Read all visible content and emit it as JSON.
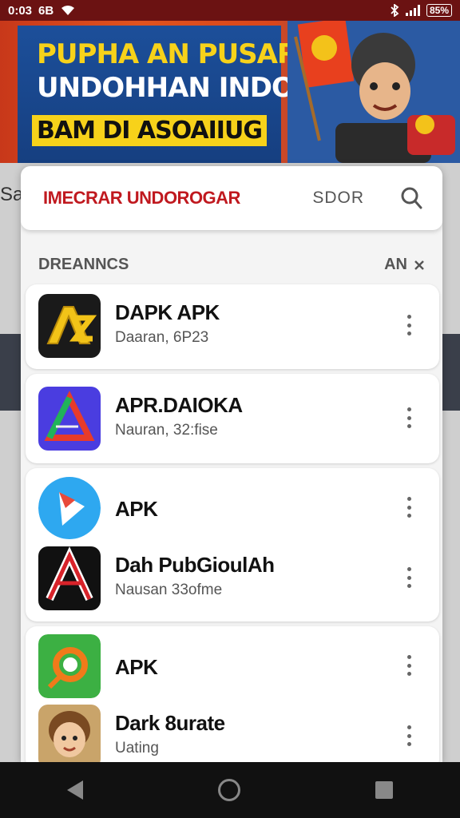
{
  "status": {
    "time": "0:03",
    "carrier": "6B",
    "battery": "85%"
  },
  "banner": {
    "line1": "PUPHA AN PUSAR",
    "line2": "UNDOHHAN INDONSIA",
    "line3": "BAM DI ASOAIIUG"
  },
  "background": {
    "left_text": "Sa"
  },
  "search": {
    "value": "IMECRAR UNDOROGAR",
    "button": "SDOR"
  },
  "section": {
    "title": "DREANNCS",
    "action": "AN"
  },
  "apps": [
    {
      "name": "DAPK APK",
      "sub": "Daaran, 6P23"
    },
    {
      "name": "APR.DAIOKA",
      "sub": "Nauran, 32:fise"
    },
    {
      "name": "APK",
      "sub": ""
    },
    {
      "name": "Dah PubGioulAh",
      "sub": "Nausan 33ofme"
    },
    {
      "name": "APK",
      "sub": ""
    },
    {
      "name": "Dark 8urate",
      "sub": "Uating"
    }
  ]
}
